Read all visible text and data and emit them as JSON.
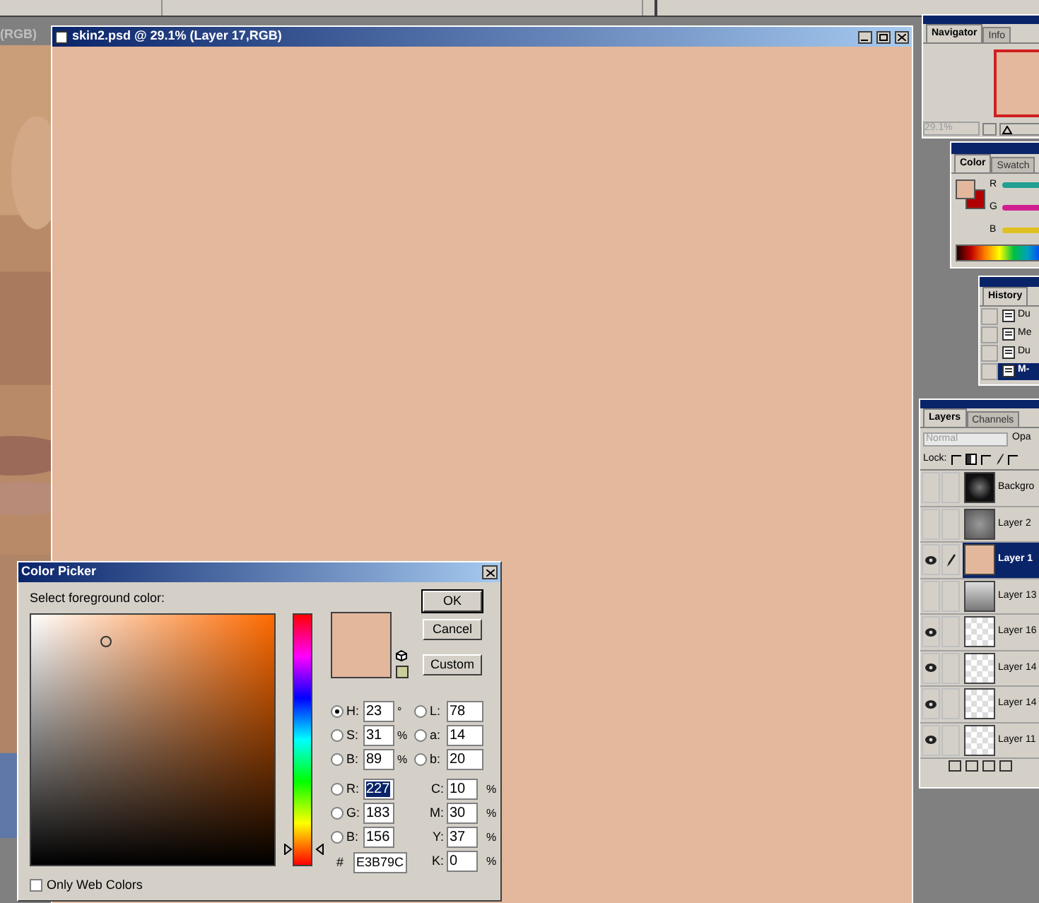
{
  "left_window": {
    "title": "(RGB)",
    "kind": "picture"
  },
  "document": {
    "title": "skin2.psd @ 29.1% (Layer 17,RGB)"
  },
  "navigator": {
    "tabs": [
      {
        "label": "Navigator",
        "selected": true
      },
      {
        "label": "Info",
        "selected": false
      }
    ],
    "zoom": "29.1%",
    "slider": {
      "level": 0.02
    }
  },
  "color_palette": {
    "tabs": [
      {
        "label": "Color",
        "selected": true
      },
      {
        "label": "Swatch",
        "selected": false
      }
    ],
    "sliders": [
      {
        "label": "R",
        "color": "#20a090"
      },
      {
        "label": "G",
        "color": "#d02090"
      },
      {
        "label": "B",
        "color": "#e0c020"
      }
    ]
  },
  "history": {
    "tabs": [
      {
        "label": "History",
        "selected": true
      }
    ],
    "items": [
      {
        "label": "Du",
        "selected": false,
        "snapshot": false
      },
      {
        "label": "Me",
        "selected": false,
        "snapshot": false
      },
      {
        "label": "Du",
        "selected": false,
        "snapshot": false
      },
      {
        "label": "M-",
        "selected": true,
        "snapshot": false
      }
    ]
  },
  "layers": {
    "tabs": [
      {
        "label": "Layers",
        "selected": true
      },
      {
        "label": "Channels",
        "selected": false
      }
    ],
    "blend_mode": "Normal",
    "opacity_label": "Opa",
    "lock_label": "Lock:",
    "locks": [
      {
        "checked": false
      },
      {
        "checked": false
      },
      {
        "checked": false
      }
    ],
    "items": [
      {
        "name": "Backgro",
        "visible": false,
        "brush": false,
        "selected": false,
        "kind": "dark"
      },
      {
        "name": "Layer 2",
        "visible": false,
        "brush": false,
        "selected": false,
        "kind": "gray"
      },
      {
        "name": "Layer 1",
        "visible": true,
        "brush": true,
        "selected": true,
        "kind": "skin"
      },
      {
        "name": "Layer 13",
        "visible": false,
        "brush": false,
        "selected": false,
        "kind": "light"
      },
      {
        "name": "Layer 16",
        "visible": true,
        "brush": false,
        "selected": false,
        "kind": "transparent"
      },
      {
        "name": "Layer 14",
        "visible": true,
        "brush": false,
        "selected": false,
        "kind": "transparent"
      },
      {
        "name": "Layer 14",
        "visible": true,
        "brush": false,
        "selected": false,
        "kind": "transparent"
      },
      {
        "name": "Layer 11",
        "visible": true,
        "brush": false,
        "selected": false,
        "kind": "transparent"
      }
    ]
  },
  "color_picker": {
    "title": "Color Picker",
    "prompt": "Select foreground color:",
    "buttons": [
      "OK",
      "Cancel",
      "Custom"
    ],
    "left_fields": [
      {
        "label": "H:",
        "value": "23",
        "unit": "°",
        "selected": true,
        "highlighted": false
      },
      {
        "label": "S:",
        "value": "31",
        "unit": "%",
        "selected": false,
        "highlighted": false
      },
      {
        "label": "B:",
        "value": "89",
        "unit": "%",
        "selected": false,
        "highlighted": false
      },
      {
        "label": "R:",
        "value": "227",
        "selected": false,
        "highlighted": true
      },
      {
        "label": "G:",
        "value": "183",
        "selected": false,
        "highlighted": false
      },
      {
        "label": "B:",
        "value": "156",
        "selected": false,
        "highlighted": false
      }
    ],
    "right_fields": [
      {
        "kind": "radio",
        "label": "L:",
        "value": "78",
        "selected": false
      },
      {
        "kind": "radio",
        "label": "a:",
        "value": "14",
        "selected": false
      },
      {
        "kind": "radio",
        "label": "b:",
        "value": "20",
        "selected": false
      },
      {
        "kind": "plain",
        "label": "C:",
        "value": "10",
        "unit": "%"
      },
      {
        "kind": "plain",
        "label": "M:",
        "value": "30",
        "unit": "%"
      },
      {
        "kind": "plain",
        "label": "Y:",
        "value": "37",
        "unit": "%"
      },
      {
        "kind": "plain",
        "label": "K:",
        "value": "0",
        "unit": "%"
      }
    ],
    "hue_slider": {
      "level": 0.064
    },
    "hex_label": "#",
    "hex": "E3B79C",
    "web_colors": {
      "label": "Only Web Colors",
      "checked": false
    }
  }
}
